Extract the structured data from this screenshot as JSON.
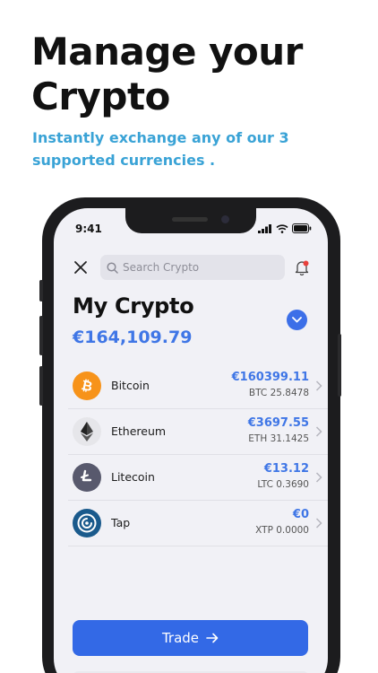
{
  "marketing": {
    "headline_line1": "Manage your",
    "headline_line2": "Crypto",
    "subline": "Instantly exchange any of our 3 supported currencies ."
  },
  "status_bar": {
    "time": "9:41"
  },
  "header": {
    "search_placeholder": "Search Crypto",
    "close_icon": "close-icon",
    "bell_icon": "bell-icon",
    "notification_color": "#e8403c"
  },
  "wallet": {
    "title": "My Crypto",
    "total": "€164,109.79",
    "accent": "#3f76e6"
  },
  "coins": [
    {
      "name": "Bitcoin",
      "value": "€160399.11",
      "amount": "BTC 25.8478",
      "icon": "bitcoin-icon",
      "color": "#f7931a"
    },
    {
      "name": "Ethereum",
      "value": "€3697.55",
      "amount": "ETH 31.1425",
      "icon": "ethereum-icon",
      "color": "#e6e6ea"
    },
    {
      "name": "Litecoin",
      "value": "€13.12",
      "amount": "LTC 0.3690",
      "icon": "litecoin-icon",
      "color": "#58596d"
    },
    {
      "name": "Tap",
      "value": "€0",
      "amount": "XTP 0.0000",
      "icon": "tap-icon",
      "color": "#1a5a8c"
    }
  ],
  "actions": {
    "trade_label": "Trade"
  }
}
